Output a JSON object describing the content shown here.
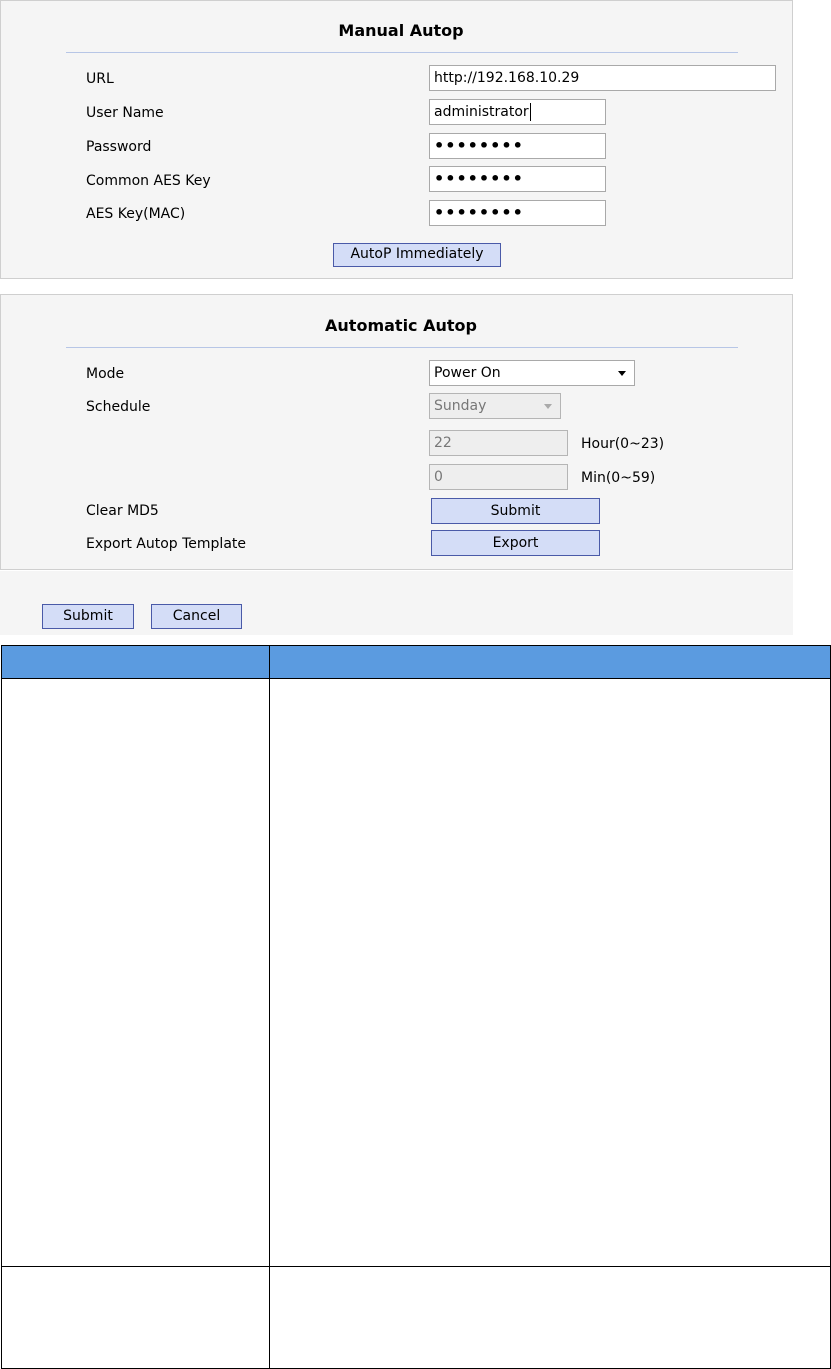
{
  "manual_autop": {
    "title": "Manual Autop",
    "url_label": "URL",
    "url_value": "http://192.168.10.29",
    "username_label": "User Name",
    "username_value": "administrator",
    "password_label": "Password",
    "password_value": "••••••••",
    "common_aes_label": "Common AES Key",
    "common_aes_value": "••••••••",
    "aes_mac_label": "AES Key(MAC)",
    "aes_mac_value": "••••••••",
    "autop_button": "AutoP Immediately"
  },
  "automatic_autop": {
    "title": "Automatic Autop",
    "mode_label": "Mode",
    "mode_value": "Power On",
    "schedule_label": "Schedule",
    "schedule_value": "Sunday",
    "hour_value": "22",
    "hour_unit": "Hour(0~23)",
    "min_value": "0",
    "min_unit": "Min(0~59)",
    "clear_md5_label": "Clear MD5",
    "clear_md5_button": "Submit",
    "export_label": "Export Autop Template",
    "export_button": "Export"
  },
  "footer": {
    "submit": "Submit",
    "cancel": "Cancel"
  }
}
